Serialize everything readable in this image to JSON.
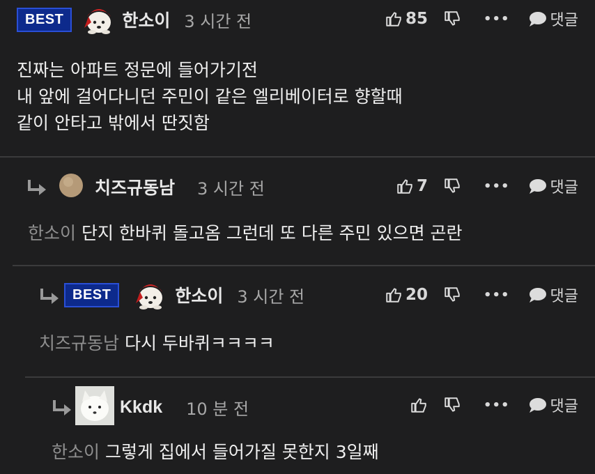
{
  "colors": {
    "background": "#1e1e1f",
    "badge": "#0d2a8c",
    "text": "#f0f0f0",
    "muted": "#8f8f8f"
  },
  "comments": [
    {
      "badge": "BEST",
      "nick": "한소이",
      "time": "3 시간 전",
      "likes": "85",
      "reply": "댓글",
      "lines": [
        "진짜는 아파트 정문에 들어가기전",
        "내 앞에 걸어다니던 주민이 같은 엘리베이터로 향할때",
        "같이 안타고 밖에서 딴짓함"
      ]
    },
    {
      "nick": "치즈규동남",
      "time": "3 시간 전",
      "likes": "7",
      "reply": "댓글",
      "mention": "한소이",
      "text": "단지 한바퀴 돌고옴 그런데 또 다른 주민 있으면 곤란"
    },
    {
      "badge": "BEST",
      "nick": "한소이",
      "time": "3 시간 전",
      "likes": "20",
      "reply": "댓글",
      "mention": "치즈규동남",
      "text": "다시 두바퀴ㅋㅋㅋㅋ"
    },
    {
      "nick": "Kkdk",
      "time": "10 분 전",
      "likes": "",
      "reply": "댓글",
      "mention": "한소이",
      "text": "그렇게 집에서 들어가질 못한지 3일째"
    }
  ],
  "icons": [
    "thumbs-up-icon",
    "thumbs-down-icon",
    "more-icon",
    "chat-bubble-icon",
    "reply-arrow-icon"
  ]
}
